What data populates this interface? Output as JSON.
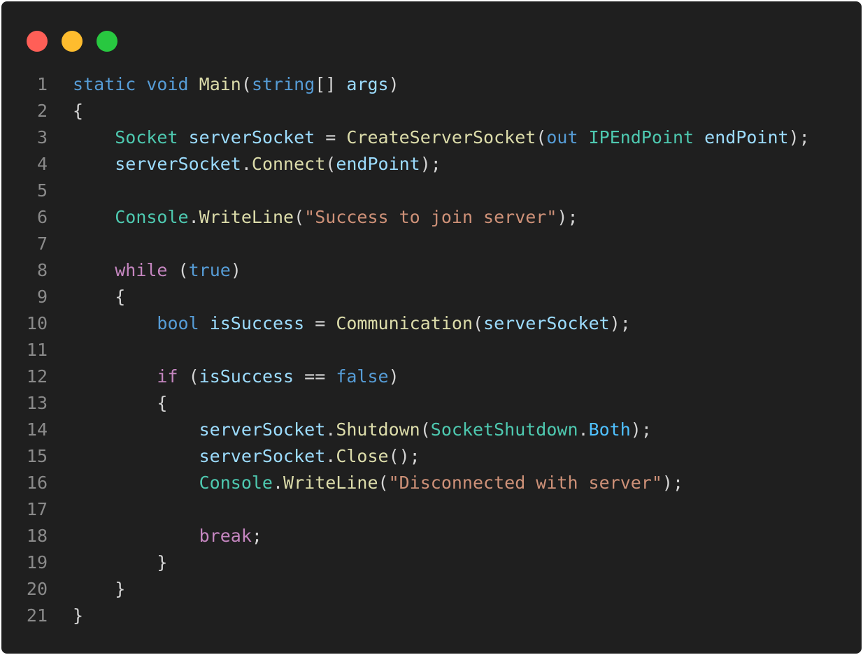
{
  "window": {
    "buttons": [
      {
        "name": "close",
        "color": "#ff5f57"
      },
      {
        "name": "minimize",
        "color": "#febc2e"
      },
      {
        "name": "maximize",
        "color": "#28c840"
      }
    ]
  },
  "code": {
    "language": "C#",
    "lines": [
      {
        "n": "1",
        "tokens": [
          [
            "kw",
            "static"
          ],
          [
            "pn",
            " "
          ],
          [
            "kw",
            "void"
          ],
          [
            "pn",
            " "
          ],
          [
            "fn",
            "Main"
          ],
          [
            "pn",
            "("
          ],
          [
            "kw",
            "string"
          ],
          [
            "pn",
            "[] "
          ],
          [
            "var",
            "args"
          ],
          [
            "pn",
            ")"
          ]
        ]
      },
      {
        "n": "2",
        "tokens": [
          [
            "pn",
            "{"
          ]
        ]
      },
      {
        "n": "3",
        "tokens": [
          [
            "pn",
            "    "
          ],
          [
            "ty",
            "Socket"
          ],
          [
            "pn",
            " "
          ],
          [
            "var",
            "serverSocket"
          ],
          [
            "pn",
            " = "
          ],
          [
            "fn",
            "CreateServerSocket"
          ],
          [
            "pn",
            "("
          ],
          [
            "kw",
            "out"
          ],
          [
            "pn",
            " "
          ],
          [
            "ty",
            "IPEndPoint"
          ],
          [
            "pn",
            " "
          ],
          [
            "var",
            "endPoint"
          ],
          [
            "pn",
            ");"
          ]
        ]
      },
      {
        "n": "4",
        "tokens": [
          [
            "pn",
            "    "
          ],
          [
            "var",
            "serverSocket"
          ],
          [
            "pn",
            "."
          ],
          [
            "fn",
            "Connect"
          ],
          [
            "pn",
            "("
          ],
          [
            "var",
            "endPoint"
          ],
          [
            "pn",
            ");"
          ]
        ]
      },
      {
        "n": "5",
        "tokens": []
      },
      {
        "n": "6",
        "tokens": [
          [
            "pn",
            "    "
          ],
          [
            "ty",
            "Console"
          ],
          [
            "pn",
            "."
          ],
          [
            "fn",
            "WriteLine"
          ],
          [
            "pn",
            "("
          ],
          [
            "str",
            "\"Success to join server\""
          ],
          [
            "pn",
            ");"
          ]
        ]
      },
      {
        "n": "7",
        "tokens": []
      },
      {
        "n": "8",
        "tokens": [
          [
            "pn",
            "    "
          ],
          [
            "ctl",
            "while"
          ],
          [
            "pn",
            " ("
          ],
          [
            "kw",
            "true"
          ],
          [
            "pn",
            ")"
          ]
        ]
      },
      {
        "n": "9",
        "tokens": [
          [
            "pn",
            "    {"
          ]
        ]
      },
      {
        "n": "10",
        "tokens": [
          [
            "pn",
            "        "
          ],
          [
            "kw",
            "bool"
          ],
          [
            "pn",
            " "
          ],
          [
            "var",
            "isSuccess"
          ],
          [
            "pn",
            " = "
          ],
          [
            "fn",
            "Communication"
          ],
          [
            "pn",
            "("
          ],
          [
            "var",
            "serverSocket"
          ],
          [
            "pn",
            ");"
          ]
        ]
      },
      {
        "n": "11",
        "tokens": []
      },
      {
        "n": "12",
        "tokens": [
          [
            "pn",
            "        "
          ],
          [
            "ctl",
            "if"
          ],
          [
            "pn",
            " ("
          ],
          [
            "var",
            "isSuccess"
          ],
          [
            "pn",
            " == "
          ],
          [
            "kw",
            "false"
          ],
          [
            "pn",
            ")"
          ]
        ]
      },
      {
        "n": "13",
        "tokens": [
          [
            "pn",
            "        {"
          ]
        ]
      },
      {
        "n": "14",
        "tokens": [
          [
            "pn",
            "            "
          ],
          [
            "var",
            "serverSocket"
          ],
          [
            "pn",
            "."
          ],
          [
            "fn",
            "Shutdown"
          ],
          [
            "pn",
            "("
          ],
          [
            "ty",
            "SocketShutdown"
          ],
          [
            "pn",
            "."
          ],
          [
            "enm",
            "Both"
          ],
          [
            "pn",
            ");"
          ]
        ]
      },
      {
        "n": "15",
        "tokens": [
          [
            "pn",
            "            "
          ],
          [
            "var",
            "serverSocket"
          ],
          [
            "pn",
            "."
          ],
          [
            "fn",
            "Close"
          ],
          [
            "pn",
            "();"
          ]
        ]
      },
      {
        "n": "16",
        "tokens": [
          [
            "pn",
            "            "
          ],
          [
            "ty",
            "Console"
          ],
          [
            "pn",
            "."
          ],
          [
            "fn",
            "WriteLine"
          ],
          [
            "pn",
            "("
          ],
          [
            "str",
            "\"Disconnected with server\""
          ],
          [
            "pn",
            ");"
          ]
        ]
      },
      {
        "n": "17",
        "tokens": []
      },
      {
        "n": "18",
        "tokens": [
          [
            "pn",
            "            "
          ],
          [
            "ctl",
            "break"
          ],
          [
            "pn",
            ";"
          ]
        ]
      },
      {
        "n": "19",
        "tokens": [
          [
            "pn",
            "        }"
          ]
        ]
      },
      {
        "n": "20",
        "tokens": [
          [
            "pn",
            "    }"
          ]
        ]
      },
      {
        "n": "21",
        "tokens": [
          [
            "pn",
            "}"
          ]
        ]
      }
    ]
  }
}
